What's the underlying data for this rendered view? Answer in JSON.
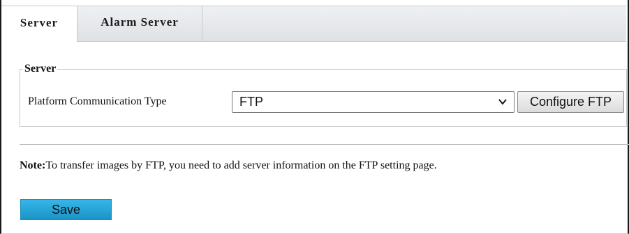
{
  "tabs": [
    {
      "label": "Server",
      "active": true
    },
    {
      "label": "Alarm Server",
      "active": false
    }
  ],
  "server_section": {
    "legend": "Server",
    "platform_label": "Platform Communication Type",
    "platform_value": "FTP",
    "configure_button": "Configure FTP"
  },
  "note": {
    "prefix": "Note:",
    "text": "To transfer images by FTP, you need to add server information on the FTP setting page."
  },
  "save_button": "Save",
  "colors": {
    "save_button": "#1b93c8",
    "tabbar": "#dfe2e5"
  },
  "icons": {
    "dropdown": "chevron-down-icon"
  }
}
